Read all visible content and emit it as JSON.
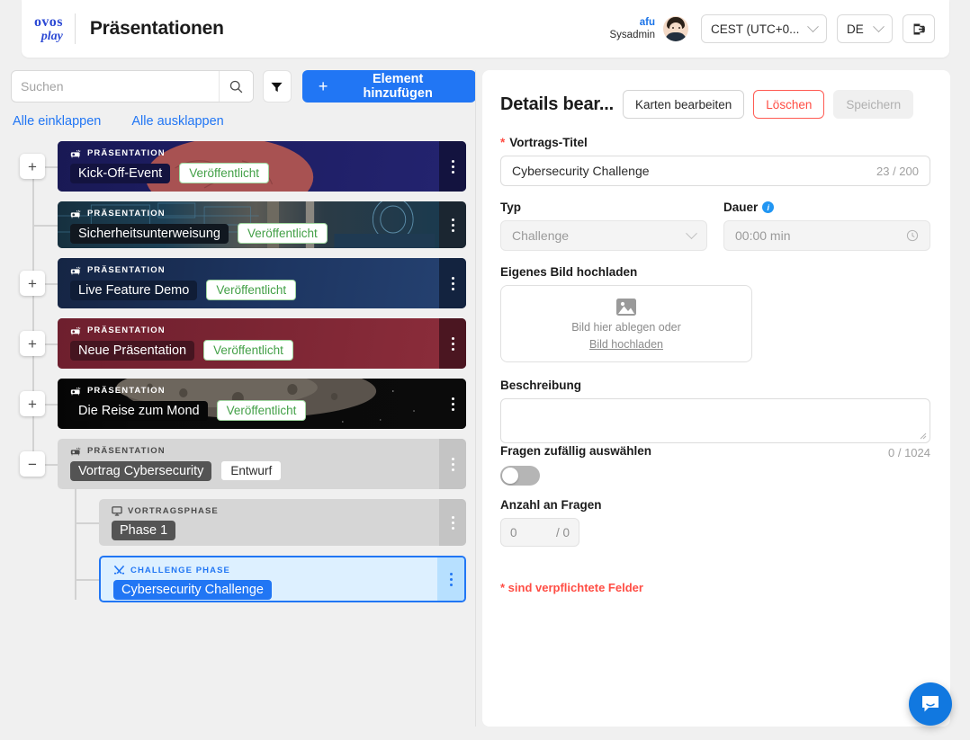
{
  "header": {
    "logo_line1": "ovos",
    "logo_line2": "play",
    "page_title": "Präsentationen",
    "user_name": "afu",
    "user_role": "Sysadmin",
    "timezone": "CEST (UTC+0...",
    "language": "DE",
    "logout_icon": "logout-icon",
    "avatar_icon": "user-avatar"
  },
  "toolbar": {
    "search_placeholder": "Suchen",
    "search_value": "",
    "search_icon": "search-icon",
    "filter_icon": "filter-icon",
    "add_label": "Element hinzufügen",
    "add_icon": "plus-icon",
    "collapse_all": "Alle einklappen",
    "expand_all": "Alle ausklappen"
  },
  "tree": {
    "items": [
      {
        "kicker": "PRÄSENTATION",
        "icon": "projector-icon",
        "name": "Kick-Off-Event",
        "status": "Veröffentlicht",
        "status_kind": "pub",
        "toggle": "+",
        "theme": "brain"
      },
      {
        "kicker": "PRÄSENTATION",
        "icon": "projector-icon",
        "name": "Sicherheitsunterweisung",
        "status": "Veröffentlicht",
        "status_kind": "pub",
        "toggle": "",
        "theme": "cyber"
      },
      {
        "kicker": "PRÄSENTATION",
        "icon": "projector-icon",
        "name": "Live Feature Demo",
        "status": "Veröffentlicht",
        "status_kind": "pub",
        "toggle": "+",
        "theme": "navy"
      },
      {
        "kicker": "PRÄSENTATION",
        "icon": "projector-icon",
        "name": "Neue Präsentation",
        "status": "Veröffentlicht",
        "status_kind": "pub",
        "toggle": "+",
        "theme": "maroon"
      },
      {
        "kicker": "PRÄSENTATION",
        "icon": "projector-icon",
        "name": "Die Reise zum Mond",
        "status": "Veröffentlicht",
        "status_kind": "pub",
        "toggle": "+",
        "theme": "moon"
      },
      {
        "kicker": "PRÄSENTATION",
        "icon": "projector-icon",
        "name": "Vortrag Cybersecurity",
        "status": "Entwurf",
        "status_kind": "draft",
        "toggle": "−",
        "theme": "grey"
      }
    ],
    "children": [
      {
        "kicker": "VORTRAGSPHASE",
        "icon": "screen-icon",
        "name": "Phase 1",
        "selected": false
      },
      {
        "kicker": "CHALLENGE PHASE",
        "icon": "swords-icon",
        "name": "Cybersecurity Challenge",
        "selected": true
      }
    ]
  },
  "details": {
    "title": "Details bear...",
    "edit_cards_label": "Karten bearbeiten",
    "delete_label": "Löschen",
    "save_label": "Speichern",
    "title_field": {
      "label": "Vortrags-Titel",
      "required_marker": "*",
      "value": "Cybersecurity Challenge",
      "counter": "23 / 200"
    },
    "type_field": {
      "label": "Typ",
      "value": "Challenge",
      "chevron_icon": "chevron-down-icon"
    },
    "duration_field": {
      "label": "Dauer",
      "info_icon": "info-icon",
      "placeholder": "00:00 min",
      "clock_icon": "clock-icon"
    },
    "upload": {
      "label": "Eigenes Bild hochladen",
      "image_icon": "image-icon",
      "drop_text": "Bild hier ablegen oder",
      "link_text": "Bild hochladen"
    },
    "description": {
      "label": "Beschreibung",
      "value": "",
      "counter": "0 / 1024"
    },
    "random_questions": {
      "label": "Fragen zufällig auswählen",
      "enabled": false
    },
    "question_count": {
      "label": "Anzahl an Fragen",
      "value": "0",
      "max": "/ 0"
    },
    "required_note": "* sind verpflichtete Felder"
  },
  "widget": {
    "chat_icon": "chat-bubble-icon"
  },
  "colors": {
    "accent": "#2176f4",
    "danger": "#ff4d44",
    "published": "#43a047",
    "page_bg": "#f0f0f0"
  }
}
